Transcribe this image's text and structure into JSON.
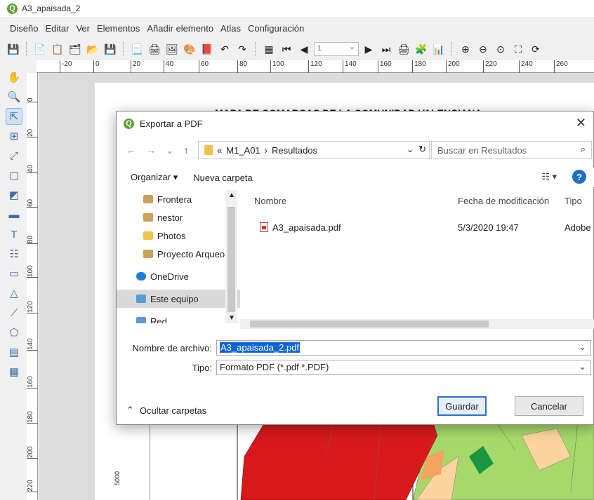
{
  "window": {
    "title": "A3_apaisada_2"
  },
  "menu": [
    "Diseño",
    "Editar",
    "Ver",
    "Elementos",
    "Añadir elemento",
    "Atlas",
    "Configuración"
  ],
  "toolbar": {
    "page_number": "1"
  },
  "ruler_h": [
    "-20",
    "0",
    "20",
    "40",
    "60",
    "80",
    "100",
    "120",
    "140",
    "160",
    "180",
    "200",
    "220",
    "240",
    "260"
  ],
  "ruler_v": [
    "0",
    "20",
    "40",
    "60",
    "80",
    "100",
    "120",
    "140",
    "160",
    "180",
    "200",
    "220"
  ],
  "map": {
    "title": "MAPA DE COMARCAS DE LA COMUNIDAD VALENCIANA",
    "coord_label": "5000",
    "colors": {
      "red": "#d7191c",
      "light_green": "#a6d96a",
      "dark_green": "#1a9641",
      "beige": "#fdd49e",
      "orange": "#f4a460"
    }
  },
  "dialog": {
    "title": "Exportar a PDF",
    "path": {
      "prefix": "«",
      "segment1": "M1_A01",
      "sep": "›",
      "segment2": "Resultados"
    },
    "search_placeholder": "Buscar en Resultados",
    "organize": "Organizar ▾",
    "new_folder": "Nueva carpeta",
    "view_icon": "view-options-icon",
    "help": "?",
    "nav_items": [
      {
        "label": "Frontera",
        "icon": "#c8a15a"
      },
      {
        "label": "nestor",
        "icon": "#c8a15a"
      },
      {
        "label": "Photos",
        "icon": "#f2c14e"
      },
      {
        "label": "Proyecto Arqueo",
        "icon": "#c8a15a"
      },
      {
        "label": "OneDrive",
        "icon": "#1e7fd8"
      },
      {
        "label": "Este equipo",
        "icon": "#5b9bd5"
      },
      {
        "label": "Red",
        "icon": "#5b9bd5"
      }
    ],
    "columns": {
      "name": "Nombre",
      "date": "Fecha de modificación",
      "type": "Tipo"
    },
    "files": [
      {
        "name": "A3_apaisada.pdf",
        "date": "5/3/2020 19:47",
        "type": "Adobe"
      }
    ],
    "filename_label": "Nombre de archivo:",
    "filename_value": "A3_apaisada_2.pdf",
    "type_label": "Tipo:",
    "type_value": "Formato PDF (*.pdf *.PDF)",
    "hide_folders": "Ocultar carpetas",
    "save": "Guardar",
    "cancel": "Cancelar"
  }
}
